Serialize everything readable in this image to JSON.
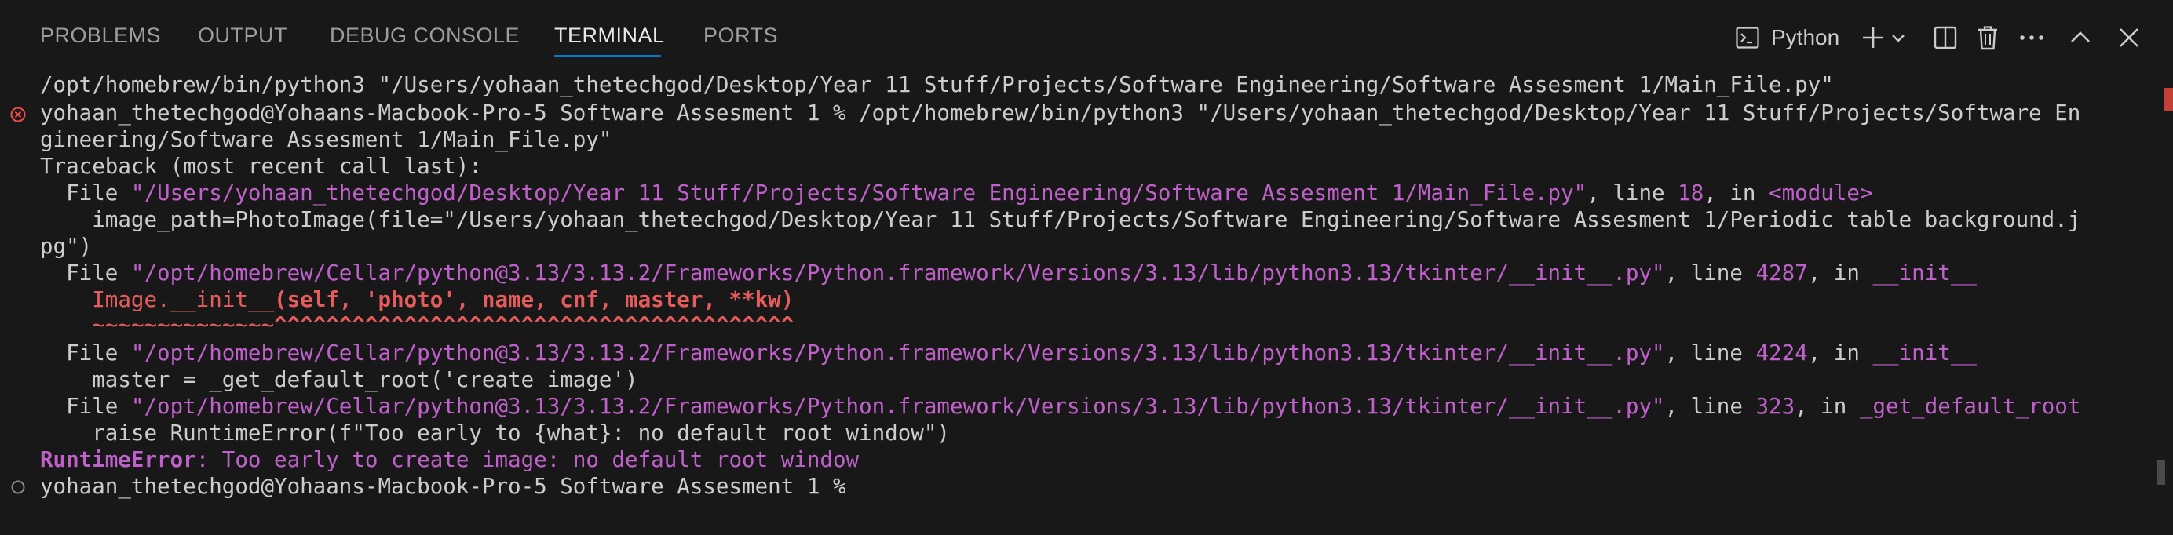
{
  "tabs": [
    {
      "label": "PROBLEMS"
    },
    {
      "label": "OUTPUT"
    },
    {
      "label": "DEBUG CONSOLE"
    },
    {
      "label": "TERMINAL"
    },
    {
      "label": "PORTS"
    }
  ],
  "toolbar": {
    "terminal_name": "Python"
  },
  "icons": {
    "terminal": "terminal-icon",
    "add": "plus-icon",
    "dropdown": "chevron-down-icon",
    "split": "split-editor-icon",
    "trash": "trash-icon",
    "more": "ellipsis-icon",
    "maximize": "chevron-up-icon",
    "close": "close-icon"
  },
  "colors": {
    "accent": "#0078d4",
    "error_decoration": "#f14c4c",
    "traceback_path": "#c061cb",
    "highlight_red": "#e65c5c"
  },
  "terminal": {
    "line01": "/opt/homebrew/bin/python3 \"/Users/yohaan_thetechgod/Desktop/Year 11 Stuff/Projects/Software Engineering/Software Assesment 1/Main_File.py\"",
    "line02": "yohaan_thetechgod@Yohaans-Macbook-Pro-5 Software Assesment 1 % /opt/homebrew/bin/python3 \"/Users/yohaan_thetechgod/Desktop/Year 11 Stuff/Projects/Software En",
    "line03": "gineering/Software Assesment 1/Main_File.py\"",
    "line04": "Traceback (most recent call last):",
    "line05_pre": "  File ",
    "line05_path": "\"/Users/yohaan_thetechgod/Desktop/Year 11 Stuff/Projects/Software Engineering/Software Assesment 1/Main_File.py\"",
    "line05_mid1": ", line ",
    "line05_num": "18",
    "line05_mid2": ", in ",
    "line05_mod": "<module>",
    "line06": "    image_path=PhotoImage(file=\"/Users/yohaan_thetechgod/Desktop/Year 11 Stuff/Projects/Software Engineering/Software Assesment 1/Periodic table background.j",
    "line07": "pg\")",
    "line08_pre": "  File ",
    "line08_path": "\"/opt/homebrew/Cellar/python@3.13/3.13.2/Frameworks/Python.framework/Versions/3.13/lib/python3.13/tkinter/__init__.py\"",
    "line08_mid1": ", line ",
    "line08_num": "4287",
    "line08_mid2": ", in ",
    "line08_mod": "__init__",
    "line09_pre": "    ",
    "line09_a": "Image.__init__",
    "line09_b": "(self, 'photo', name, cnf, master, **kw)",
    "line10_pre": "    ",
    "line10_a": "~~~~~~~~~~~~~~",
    "line10_b": "^^^^^^^^^^^^^^^^^^^^^^^^^^^^^^^^^^^^^^^^",
    "line11_pre": "  File ",
    "line11_path": "\"/opt/homebrew/Cellar/python@3.13/3.13.2/Frameworks/Python.framework/Versions/3.13/lib/python3.13/tkinter/__init__.py\"",
    "line11_mid1": ", line ",
    "line11_num": "4224",
    "line11_mid2": ", in ",
    "line11_mod": "__init__",
    "line12": "    master = _get_default_root('create image')",
    "line13_pre": "  File ",
    "line13_path": "\"/opt/homebrew/Cellar/python@3.13/3.13.2/Frameworks/Python.framework/Versions/3.13/lib/python3.13/tkinter/__init__.py\"",
    "line13_mid1": ", line ",
    "line13_num": "323",
    "line13_mid2": ", in ",
    "line13_mod": "_get_default_root",
    "line14": "    raise RuntimeError(f\"Too early to {what}: no default root window\")",
    "line15_type": "RuntimeError",
    "line15_msg": ": Too early to create image: no default root window",
    "line16": "yohaan_thetechgod@Yohaans-Macbook-Pro-5 Software Assesment 1 % "
  }
}
